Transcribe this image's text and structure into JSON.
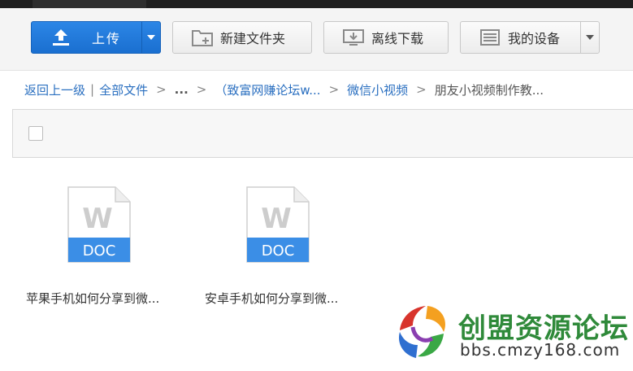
{
  "toolbar": {
    "upload_label": "上传",
    "new_folder_label": "新建文件夹",
    "offline_download_label": "离线下载",
    "my_devices_label": "我的设备"
  },
  "breadcrumb": {
    "back": "返回上一级",
    "separator_bar": "|",
    "all_files": "全部文件",
    "sep": ">",
    "ellipsis": "...",
    "folder_1": "（致富网赚论坛w...",
    "folder_2": "微信小视频",
    "current": "朋友小视频制作教..."
  },
  "files": [
    {
      "name": "苹果手机如何分享到微...",
      "type_label": "DOC",
      "letter": "W",
      "icon": "doc-file-icon"
    },
    {
      "name": "安卓手机如何分享到微...",
      "type_label": "DOC",
      "letter": "W",
      "icon": "doc-file-icon"
    }
  ],
  "watermark": {
    "title": "创盟资源论坛",
    "url": "bbs.cmzy168.com"
  },
  "icons": {
    "upload": "upload-icon",
    "new_folder": "new-folder-icon",
    "offline_download": "offline-download-icon",
    "my_devices": "device-icon",
    "dropdown": "chevron-down-icon"
  },
  "colors": {
    "primary": "#1a6fd0",
    "link": "#2a6fc0",
    "doc_band": "#3b8ee6",
    "watermark_green": "#2f8a3a"
  }
}
